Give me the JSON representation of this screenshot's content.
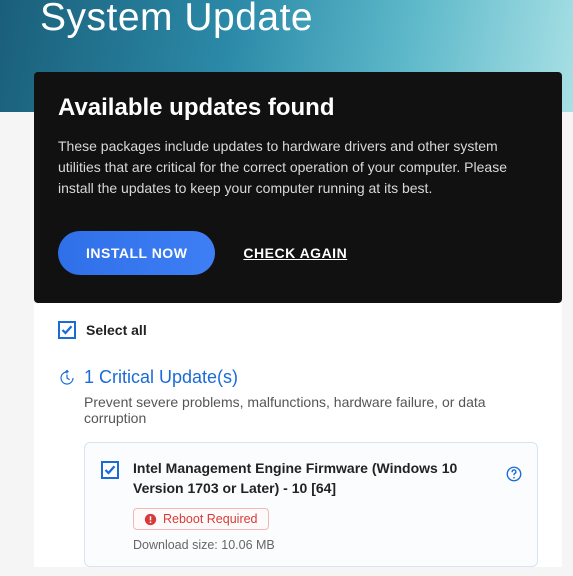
{
  "banner": {
    "title": "System Update"
  },
  "card": {
    "title": "Available updates found",
    "description": "These packages include updates to hardware drivers and other system utilities that are critical for the correct operation of your computer. Please install the updates to keep your computer running at its best.",
    "install_label": "INSTALL NOW",
    "check_again_label": "CHECK AGAIN"
  },
  "list": {
    "select_all_label": "Select all",
    "select_all_checked": true,
    "section": {
      "title": "1 Critical Update(s)",
      "description": "Prevent severe problems, malfunctions, hardware failure, or data corruption"
    },
    "items": [
      {
        "checked": true,
        "title": "Intel Management Engine Firmware (Windows 10 Version 1703 or Later) - 10 [64]",
        "reboot_label": "Reboot Required",
        "size_label": "Download size: 10.06 MB"
      }
    ]
  },
  "colors": {
    "accent": "#1a6bd8",
    "danger": "#d63b3b"
  }
}
